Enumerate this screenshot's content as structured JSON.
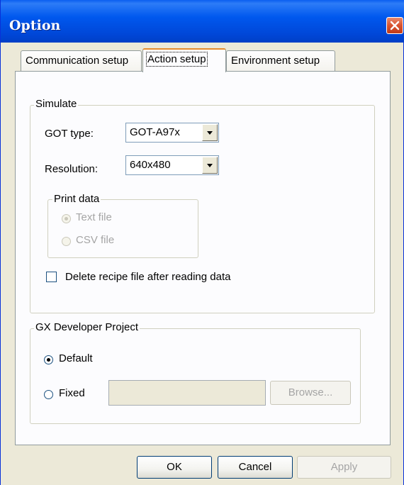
{
  "window": {
    "title": "Option"
  },
  "tabs": [
    {
      "label": "Communication setup",
      "active": false
    },
    {
      "label": "Action setup",
      "active": true
    },
    {
      "label": "Environment setup",
      "active": false
    }
  ],
  "simulate": {
    "group_label": "Simulate",
    "got_type_label": "GOT type:",
    "got_type_value": "GOT-A97x",
    "resolution_label": "Resolution:",
    "resolution_value": "640x480",
    "print_data": {
      "group_label": "Print data",
      "options": [
        {
          "label": "Text file",
          "checked": true,
          "enabled": false
        },
        {
          "label": "CSV file",
          "checked": false,
          "enabled": false
        }
      ]
    },
    "delete_recipe_label": "Delete recipe file after reading data",
    "delete_recipe_checked": false
  },
  "gx_project": {
    "group_label": "GX Developer Project",
    "default_label": "Default",
    "default_checked": true,
    "fixed_label": "Fixed",
    "fixed_checked": false,
    "path_value": "",
    "browse_label": "Browse..."
  },
  "buttons": {
    "ok": "OK",
    "cancel": "Cancel",
    "apply": "Apply"
  },
  "icons": {
    "close": "close-icon"
  }
}
